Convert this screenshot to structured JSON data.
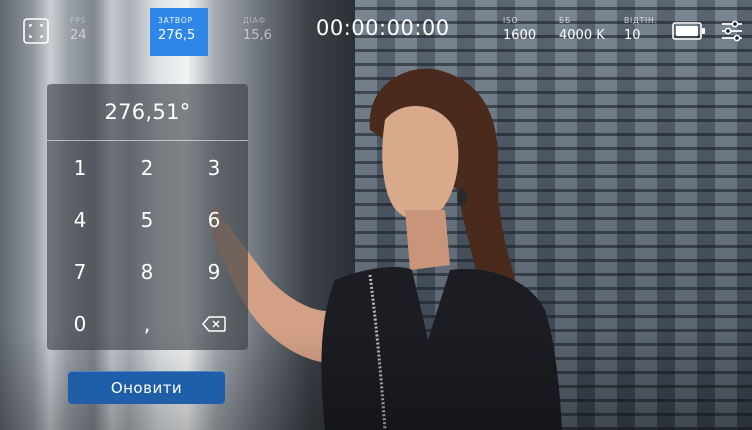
{
  "topbar": {
    "fps": {
      "label": "FPS",
      "value": "24"
    },
    "shutter": {
      "label": "ЗАТВОР",
      "value": "276,5"
    },
    "iris": {
      "label": "ДІАФ",
      "value": "15,6"
    },
    "timecode": "00:00:00:00",
    "iso": {
      "label": "ISO",
      "value": "1600"
    },
    "white_balance": {
      "label": "ББ",
      "value": "4000 K"
    },
    "tint": {
      "label": "ВІДТІН.",
      "value": "10"
    }
  },
  "keypad": {
    "display_value": "276,51°",
    "keys": [
      "1",
      "2",
      "3",
      "4",
      "5",
      "6",
      "7",
      "8",
      "9",
      "0",
      ","
    ]
  },
  "update_button": {
    "label": "Оновити"
  },
  "icons": {
    "frame_guides": "frame-guides-icon",
    "battery": "battery-icon",
    "settings": "settings-sliders-icon",
    "backspace": "backspace-icon"
  },
  "colors": {
    "accent_selected": "#2d86e8",
    "update_button": "#1f5ea8"
  }
}
